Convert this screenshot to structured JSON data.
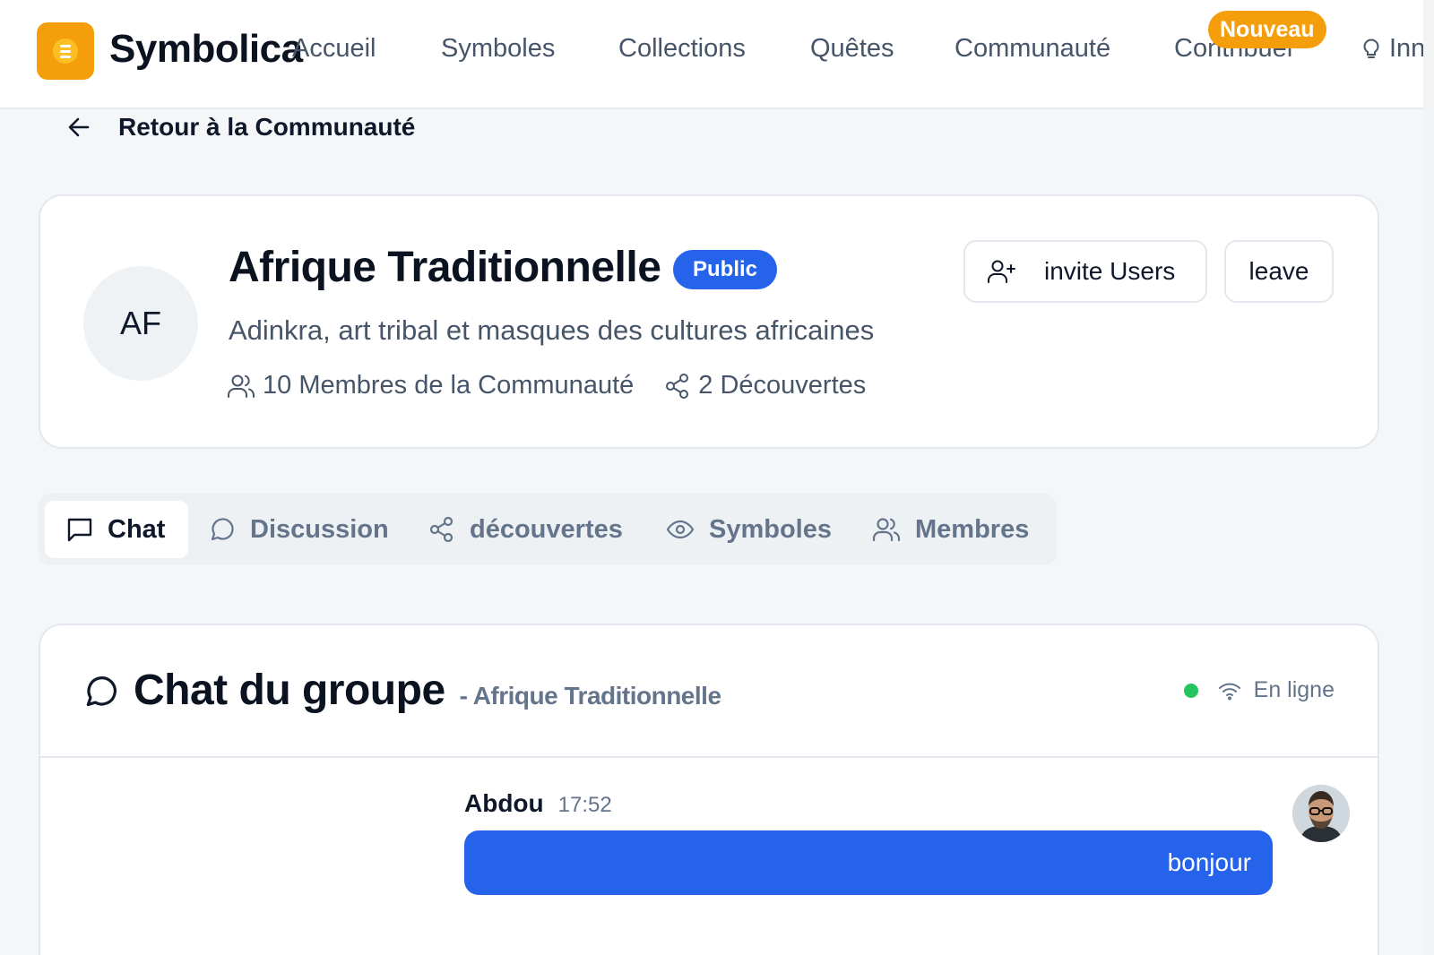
{
  "nav": {
    "brand": "Symbolica",
    "logo_icon": "logo-icon",
    "items": [
      "Accueil",
      "Symboles",
      "Collections",
      "Quêtes",
      "Communauté",
      "Contribuer",
      "Inn"
    ],
    "new_badge": "Nouveau"
  },
  "back": {
    "label": "Retour à la Communauté"
  },
  "group": {
    "initials": "AF",
    "name": "Afrique Traditionnelle",
    "visibility": "Public",
    "description": "Adinkra, art tribal et masques des cultures africaines",
    "members_stat": "10 Membres de la Communauté",
    "discoveries_stat": "2 Découvertes",
    "invite_label": "invite Users",
    "leave_label": "leave"
  },
  "tabs": [
    {
      "label": "Chat",
      "icon": "message-square-icon",
      "active": true
    },
    {
      "label": "Discussion",
      "icon": "message-circle-icon",
      "active": false
    },
    {
      "label": "découvertes",
      "icon": "share-icon",
      "active": false
    },
    {
      "label": "Symboles",
      "icon": "eye-icon",
      "active": false
    },
    {
      "label": "Membres",
      "icon": "users-icon",
      "active": false
    }
  ],
  "chat": {
    "title": "Chat du groupe",
    "subtitle": "- Afrique Traditionnelle",
    "status": "En ligne",
    "messages": [
      {
        "author": "Abdou",
        "time": "17:52",
        "text": "bonjour"
      }
    ]
  },
  "colors": {
    "accent": "#2563eb",
    "brand": "#f59e0b",
    "online": "#22c55e"
  }
}
